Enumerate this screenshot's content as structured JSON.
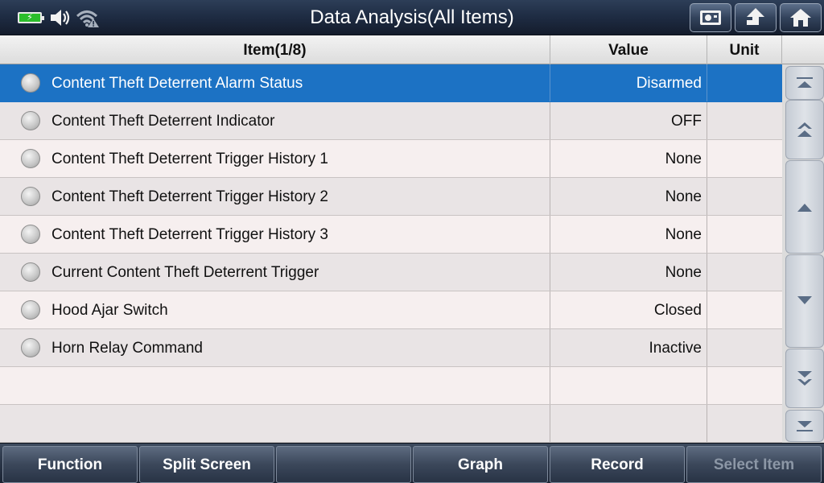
{
  "title": "Data Analysis(All Items)",
  "status": {
    "battery_icon": "battery-charging-icon",
    "volume_icon": "speaker-icon",
    "wifi_icon": "wifi-warning-icon"
  },
  "header_buttons": [
    {
      "icon": "picture-icon"
    },
    {
      "icon": "back-arrow-icon"
    },
    {
      "icon": "home-icon"
    }
  ],
  "table": {
    "columns": {
      "item": "Item(1/8)",
      "value": "Value",
      "unit": "Unit"
    },
    "rows": [
      {
        "item": "Content Theft Deterrent Alarm Status",
        "value": "Disarmed",
        "unit": ""
      },
      {
        "item": "Content Theft Deterrent Indicator",
        "value": "OFF",
        "unit": ""
      },
      {
        "item": "Content Theft Deterrent Trigger History 1",
        "value": "None",
        "unit": ""
      },
      {
        "item": "Content Theft Deterrent Trigger History 2",
        "value": "None",
        "unit": ""
      },
      {
        "item": "Content Theft Deterrent Trigger History 3",
        "value": "None",
        "unit": ""
      },
      {
        "item": "Current Content Theft Deterrent Trigger",
        "value": "None",
        "unit": ""
      },
      {
        "item": "Hood Ajar Switch",
        "value": "Closed",
        "unit": ""
      },
      {
        "item": "Horn Relay Command",
        "value": "Inactive",
        "unit": ""
      },
      {
        "item": "",
        "value": "",
        "unit": ""
      },
      {
        "item": "",
        "value": "",
        "unit": ""
      }
    ],
    "selected_row": 0
  },
  "scroll_buttons": [
    "scroll-top-icon",
    "page-up-icon",
    "line-up-icon",
    "line-down-icon",
    "page-down-icon",
    "scroll-bottom-icon"
  ],
  "footer": {
    "function": "Function",
    "split_screen": "Split Screen",
    "empty": "",
    "graph": "Graph",
    "record": "Record",
    "select_item": "Select Item"
  },
  "colors": {
    "selected_row": "#1c72c4",
    "title_bar": "#1f2d44",
    "battery": "#2bbd2b"
  }
}
